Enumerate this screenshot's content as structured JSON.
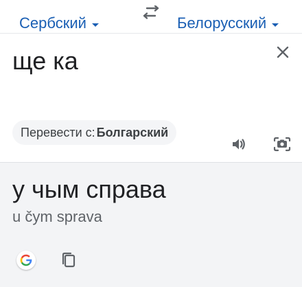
{
  "languages": {
    "source_label": "Сербский",
    "target_label": "Белорусский",
    "swap_icon": "swap-arrows-icon"
  },
  "source": {
    "text": "ще ка",
    "detect_prefix": "Перевести с:",
    "detected_language": "Болгарский"
  },
  "translation": {
    "text": "у чым справа",
    "romanization": "u čym sprava"
  },
  "colors": {
    "accent": "#1a5fb4",
    "text": "#202124",
    "muted": "#5f6368",
    "result_bg": "#f3f4f6",
    "chip_bg": "#f4f5f7"
  }
}
